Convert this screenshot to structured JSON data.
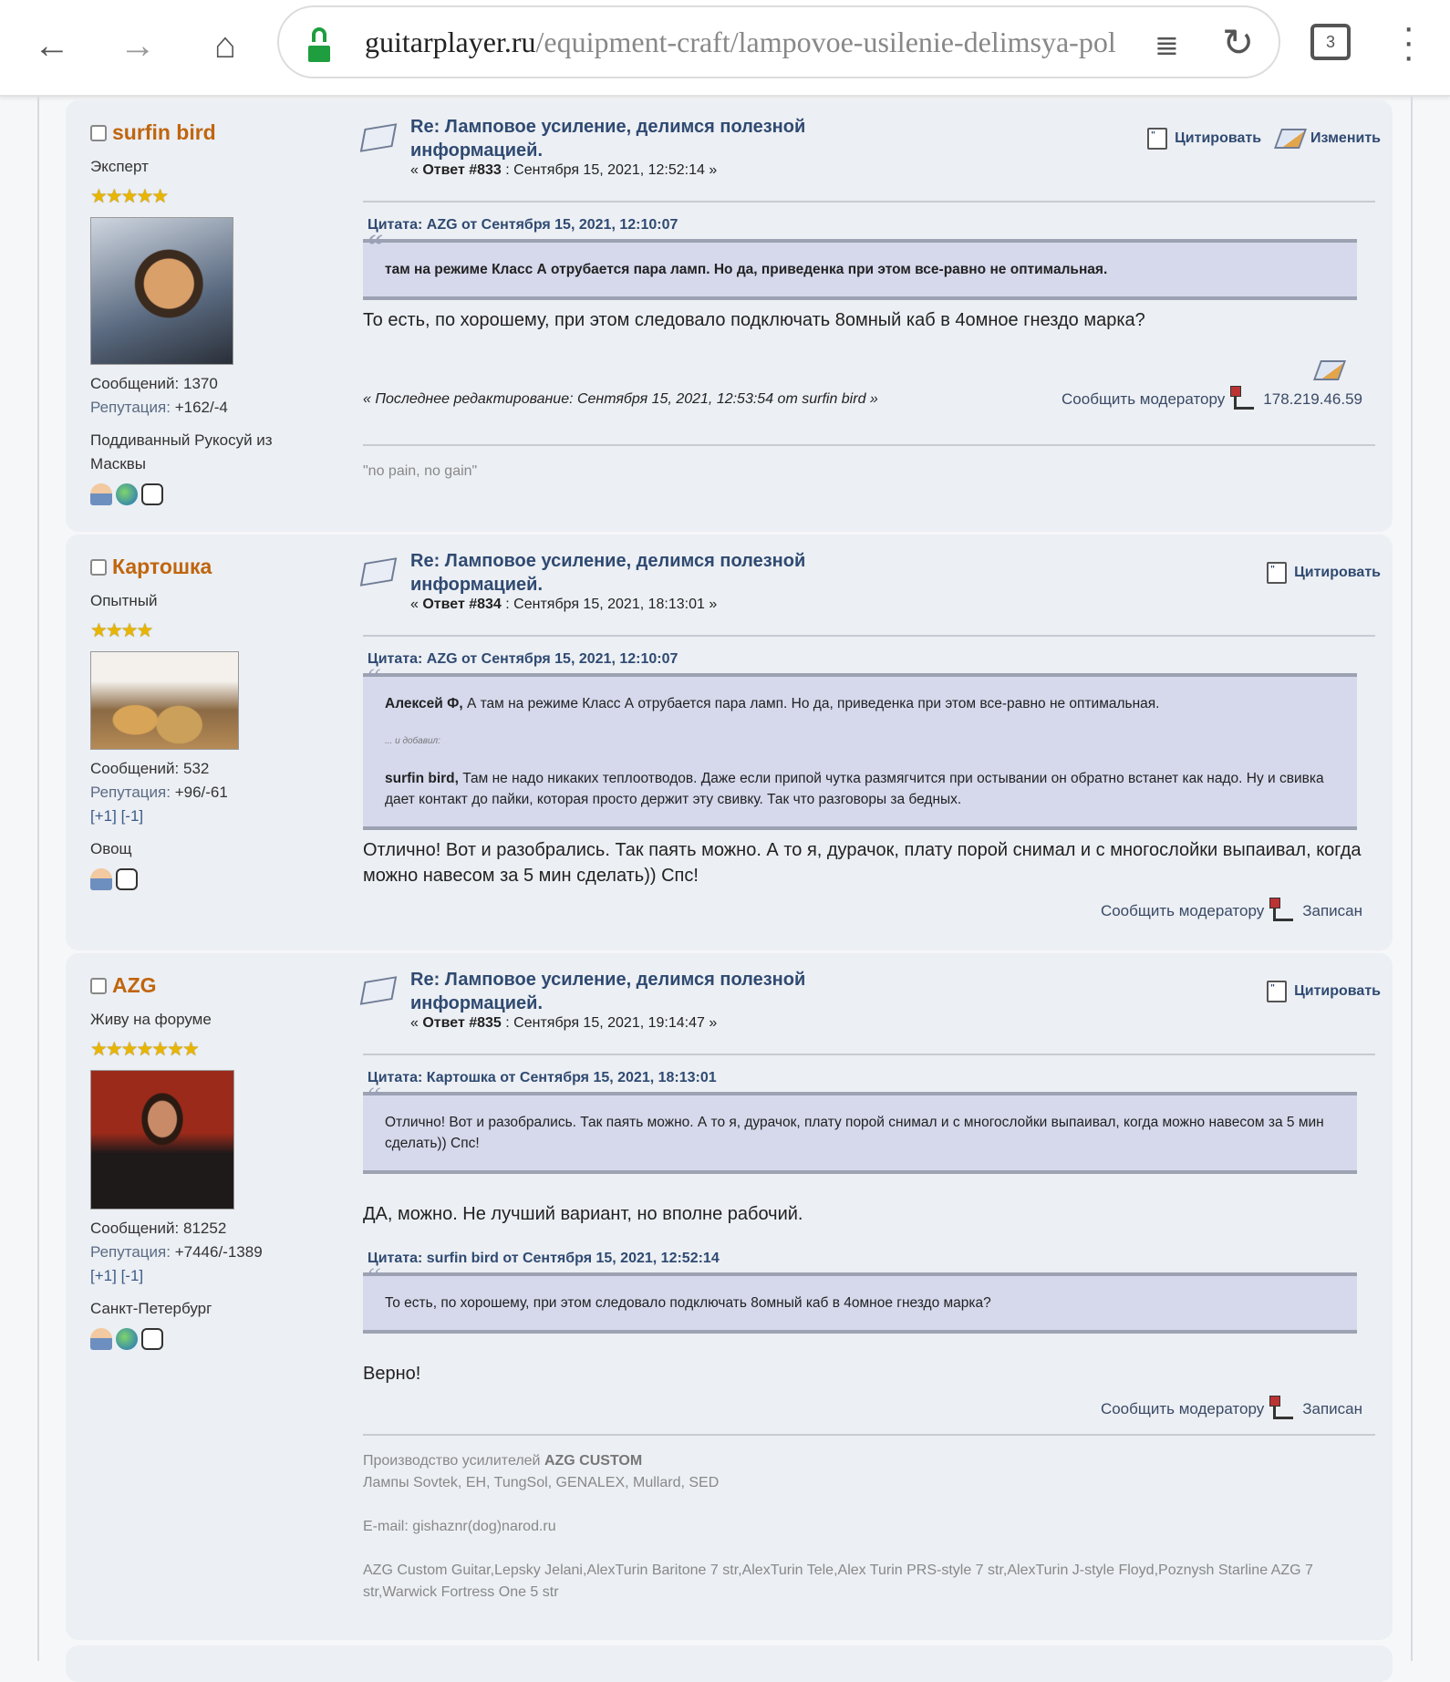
{
  "browser": {
    "url_domain": "guitarplayer.ru",
    "url_path": "/equipment-craft/lampovoe-usilenie-delimsya-pol",
    "tab_count": "3"
  },
  "labels": {
    "quote": "Цитировать",
    "modify": "Изменить",
    "report": "Сообщить модератору",
    "logged": "Записан",
    "posts_prefix": "Сообщений:",
    "rep_prefix": "Репутация:",
    "karma_plus": "[+1]",
    "karma_minus": "[-1]",
    "added": "... и добавил:"
  },
  "posts": [
    {
      "name": "surfin bird",
      "rank": "Эксперт",
      "stars": "★★★★★",
      "posts": "1370",
      "rep": "+162/-4",
      "location": "Поддиванный Рукосуй из Масквы",
      "title": "Re: Ламповое усиление, делимся полезной информацией.",
      "reply": "Ответ #833",
      "date": "Сентября 15, 2021, 12:52:14",
      "quote_head": "Цитата: AZG от Сентября 15, 2021, 12:10:07",
      "quote_text": "там на режиме Класс А отрубается пара ламп. Но да, приведенка при этом все-равно не оптимальная.",
      "body": "То есть, по хорошему, при этом следовало подключать 8омный каб в 4омное гнездо марка?",
      "last_edit": "« Последнее редактирование: Сентября 15, 2021, 12:53:54 от surfin bird »",
      "ip": "178.219.46.59",
      "signature": "\"no pain, no gain\""
    },
    {
      "name": "Картошка",
      "rank": "Опытный",
      "stars": "★★★★",
      "posts": "532",
      "rep": "+96/-61",
      "location": "Овощ",
      "title": "Re: Ламповое усиление, делимся полезной информацией.",
      "reply": "Ответ #834",
      "date": "Сентября 15, 2021, 18:13:01",
      "quote_head": "Цитата: AZG от Сентября 15, 2021, 12:10:07",
      "quote_author1": "Алексей Ф,",
      "quote_text1": "А там на режиме Класс А отрубается пара ламп. Но да, приведенка при этом все-равно не оптимальная.",
      "quote_author2": "surfin bird,",
      "quote_text2": "Там не надо никаких теплоотводов. Даже если припой чутка размягчится при остывании он обратно встанет как надо. Ну и свивка дает контакт до пайки, которая просто держит эту свивку. Так что разговоры за бедных.",
      "body": "Отлично! Вот и разобрались. Так паять можно. А то я, дурачок, плату порой снимал и с многослойки выпаивал, когда можно навесом за 5 мин сделать)) Спс!"
    },
    {
      "name": "AZG",
      "rank": "Живу на форуме",
      "stars": "★★★★★★★",
      "posts": "81252",
      "rep": "+7446/-1389",
      "location": "Санкт-Петербург",
      "title": "Re: Ламповое усиление, делимся полезной информацией.",
      "reply": "Ответ #835",
      "date": "Сентября 15, 2021, 19:14:47",
      "quote_head": "Цитата: Картошка от Сентября 15, 2021, 18:13:01",
      "quote_text": "Отлично! Вот и разобрались. Так паять можно. А то я, дурачок, плату порой снимал и с многослойки выпаивал, когда можно навесом за 5 мин сделать)) Спс!",
      "body": "ДА, можно. Не лучший вариант, но вполне рабочий.",
      "quote2_head": "Цитата: surfin bird от Сентября 15, 2021, 12:52:14",
      "quote2_text": "То есть, по хорошему, при этом следовало подключать 8омный каб в 4омное гнездо марка?",
      "body2": "Верно!",
      "sig_line1": "Производство усилителей",
      "sig_brand": "AZG CUSTOM",
      "sig_line2": "Лампы Sovtek, EH, TungSol, GENALEX, Mullard, SED",
      "sig_email": "E-mail: gishaznr(dog)narod.ru",
      "sig_guitars": "AZG Custom Guitar,Lepsky Jelani,AlexTurin Baritone 7 str,AlexTurin Tele,Alex Turin PRS-style 7 str,AlexTurin J-style Floyd,Poznysh Starline AZG 7 str,Warwick Fortress One 5 str"
    }
  ]
}
